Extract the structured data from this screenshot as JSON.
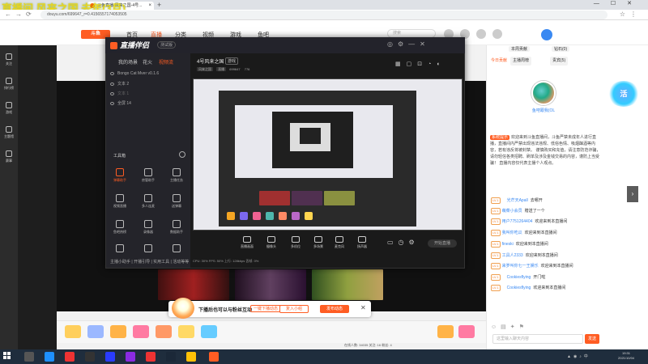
{
  "browser": {
    "tab_title": "斗鱼直播-风来之国-4号...",
    "url": "douyu.com/699647_r=0.4156557174053505",
    "overlay_title": "直播间 风来之国 去年(3月)"
  },
  "site": {
    "logo": "斗鱼",
    "nav": [
      "首页",
      "直播",
      "分类",
      "视频",
      "游戏",
      "鱼吧"
    ],
    "search_placeholder": "搜索"
  },
  "left_sidebar": [
    "关注",
    "排行榜",
    "游戏",
    "主题馆",
    "赛事"
  ],
  "tool": {
    "app_name": "直播伴侣",
    "version": "测试版",
    "tabs": [
      "我的场景",
      "花火",
      "视频流"
    ],
    "scenes": [
      "Bongo Cat Mver v0.1.6",
      "文本 2",
      "文本 1",
      "全屏 14"
    ],
    "toolbox_title": "工具箱",
    "tools": [
      "弹幕助手",
      "房管助手",
      "主播任务",
      "视频直播",
      "多人连麦",
      "送弹幕",
      "鱼吧热榜",
      "录像器",
      "数据助手",
      "...",
      "...",
      "..."
    ],
    "bottom_tip": "主播小助手 | 开播引导 | 实用工具 | 活动等等",
    "room_title": "4号风来之国",
    "room_tag": "游戏",
    "room_sub": [
      "风来之国",
      "直播",
      "699647",
      "776"
    ],
    "controls": [
      "直播画面",
      "摄像头",
      "多机位",
      "多场景",
      "麦克风",
      "扬声器"
    ],
    "start_button": "开始直播",
    "stats": "CPU: 30%    FPS: 50%    上行: 128kbps    丢帧: 0%"
  },
  "popup": {
    "text": "下播后也可以与粉丝互动",
    "link": "一键下播动态",
    "button_secondary": "复入小组",
    "button_primary": "发布动态"
  },
  "right_panel": {
    "tabs": [
      "今日贡献",
      "主播周榜",
      "本周贡献",
      "贵宾(5)",
      "钻石(0)"
    ],
    "avatar_name": "鱼吧跟我(OL",
    "notice_tag": "系统提示",
    "notice": "欢迎来到斗鱼直播间，斗鱼严禁未成年人进行直播，直播间内严禁出现违法违规、低俗色情、吸烟酗酒等内容，若有违反将被封禁。 谨慎购买和充值，请注意防范诈骗，请勿轻信各类招聘、刷单及涉及金钱交易的内容，谨防上当受骗！ 直播内容仅代表主播个人观点。",
    "chat": [
      {
        "lv": "LV.1",
        "user": "光芒天Apall",
        "msg": "去哪开"
      },
      {
        "lv": "LV.1",
        "user": "萌菜小会员",
        "msg": "赠送了一个"
      },
      {
        "lv": "LV.1",
        "user": "用户7751264404",
        "msg": "欢迎来到本直播间"
      },
      {
        "lv": "LV.1",
        "user": "我叫你吃瓜",
        "msg": "欢迎来到本直播间"
      },
      {
        "lv": "LV.1",
        "user": "fineski",
        "msg": "欢迎来到本直播间"
      },
      {
        "lv": "LV.1",
        "user": "工具人2333",
        "msg": "欢迎来到本直播间"
      },
      {
        "lv": "LV.1",
        "user": "来罗叫你七一王娱乐",
        "msg": "欢迎来到本直播间"
      },
      {
        "lv": "LV.1",
        "user": "Cookiesflying",
        "msg": "开门啦"
      },
      {
        "lv": "LV.1",
        "user": "Cookiesflying",
        "msg": "欢迎来到本直播间"
      }
    ],
    "input_placeholder": "这里输入聊天内容",
    "send_label": "发送"
  },
  "gift_stats": "在线人数: 34035   关注: 16   粉丝: 4",
  "taskbar": {
    "time": "19:31",
    "date": "2021/10/04"
  },
  "colors": {
    "accent": "#ff5d23",
    "link": "#3a89f2",
    "tool_bg": "#1a1a1a"
  }
}
